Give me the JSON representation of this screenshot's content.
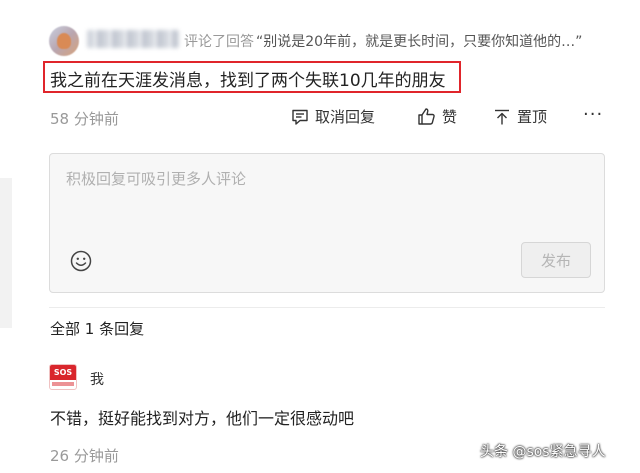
{
  "comment": {
    "reply_action": "评论了回答",
    "quote": "“别说是20年前，就是更长时间，只要你知道他的…”",
    "text": "我之前在天涯发消息，找到了两个失联10几年的朋友",
    "time": "58 分钟前",
    "actions": {
      "cancel_reply": "取消回复",
      "like": "赞",
      "pin": "置顶",
      "more": "···"
    }
  },
  "reply_box": {
    "placeholder": "积极回复可吸引更多人评论",
    "publish_label": "发布"
  },
  "replies": {
    "count_label": "全部 1 条回复",
    "items": [
      {
        "logo_text": "SOS",
        "author": "我",
        "text": "不错，挺好能找到对方，他们一定很感动吧",
        "time": "26 分钟前"
      }
    ]
  },
  "watermark": "头条 @sos紧急寻人",
  "colors": {
    "highlight_border": "#e0252b",
    "logo_red": "#d9262c",
    "muted_text": "#999999"
  }
}
